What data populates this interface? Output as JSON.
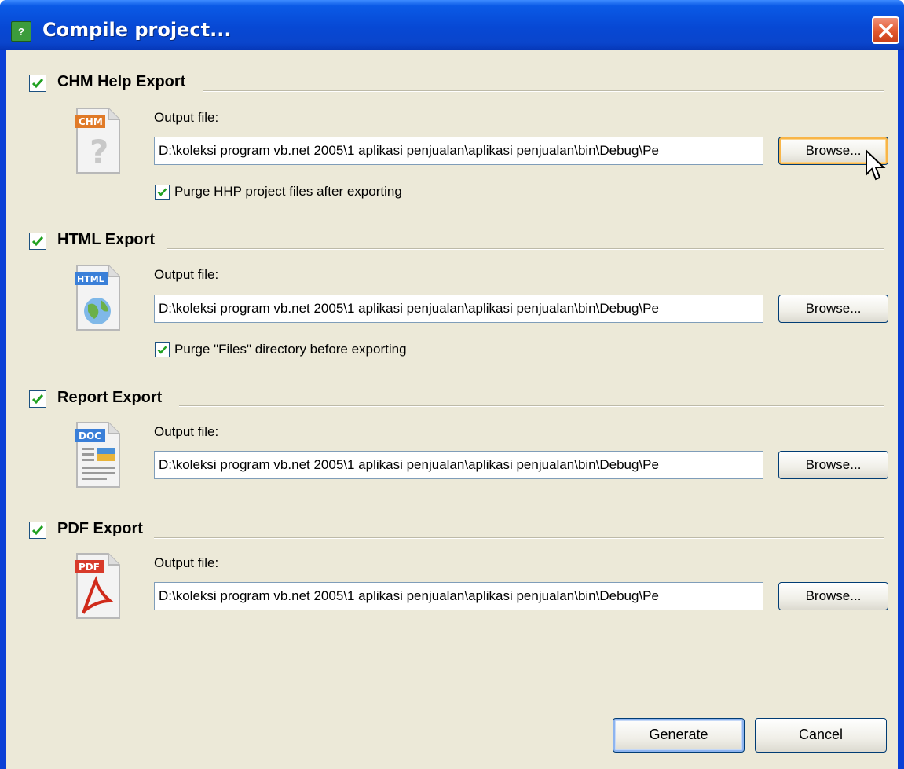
{
  "window": {
    "title": "Compile project..."
  },
  "sections": [
    {
      "title": "CHM Help Export",
      "checked": true,
      "icon": "chm-file-icon",
      "icon_label": "CHM",
      "output_label": "Output file:",
      "output_value": "D:\\koleksi program vb.net 2005\\1 aplikasi penjualan\\aplikasi penjualan\\bin\\Debug\\Pe",
      "browse_label": "Browse...",
      "option_label": "Purge HHP project files after exporting",
      "option_checked": true
    },
    {
      "title": "HTML Export",
      "checked": true,
      "icon": "html-file-icon",
      "icon_label": "HTML",
      "output_label": "Output file:",
      "output_value": "D:\\koleksi program vb.net 2005\\1 aplikasi penjualan\\aplikasi penjualan\\bin\\Debug\\Pe",
      "browse_label": "Browse...",
      "option_label": "Purge \"Files\" directory before exporting",
      "option_checked": true
    },
    {
      "title": "Report Export",
      "checked": true,
      "icon": "doc-file-icon",
      "icon_label": "DOC",
      "output_label": "Output file:",
      "output_value": "D:\\koleksi program vb.net 2005\\1 aplikasi penjualan\\aplikasi penjualan\\bin\\Debug\\Pe",
      "browse_label": "Browse..."
    },
    {
      "title": "PDF Export",
      "checked": true,
      "icon": "pdf-file-icon",
      "icon_label": "PDF",
      "output_label": "Output file:",
      "output_value": "D:\\koleksi program vb.net 2005\\1 aplikasi penjualan\\aplikasi penjualan\\bin\\Debug\\Pe",
      "browse_label": "Browse..."
    }
  ],
  "footer": {
    "generate_label": "Generate",
    "cancel_label": "Cancel"
  },
  "colors": {
    "titlebar": "#0a5ae6",
    "client_bg": "#ece9d8",
    "checkmark": "#21a121",
    "close": "#e2582e"
  }
}
